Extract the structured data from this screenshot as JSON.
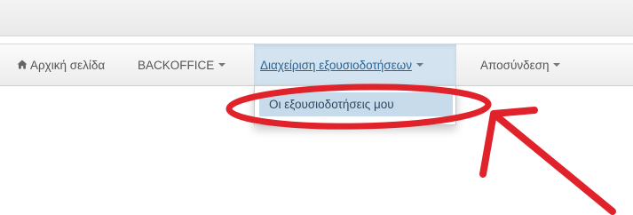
{
  "nav": {
    "home_label": "Αρχική σελίδα",
    "backoffice_label": "BACKOFFICE",
    "authorizations_label": "Διαχείριση εξουσιοδοτήσεων",
    "logout_label": "Αποσύνδεση"
  },
  "dropdown": {
    "my_authorizations_label": "Οι εξουσιοδοτήσεις μου"
  },
  "annotation": {
    "color": "#e0232b"
  },
  "colors": {
    "active_tab_bg": "#d3e4f0",
    "dropdown_item_bg": "#c8dbea"
  }
}
